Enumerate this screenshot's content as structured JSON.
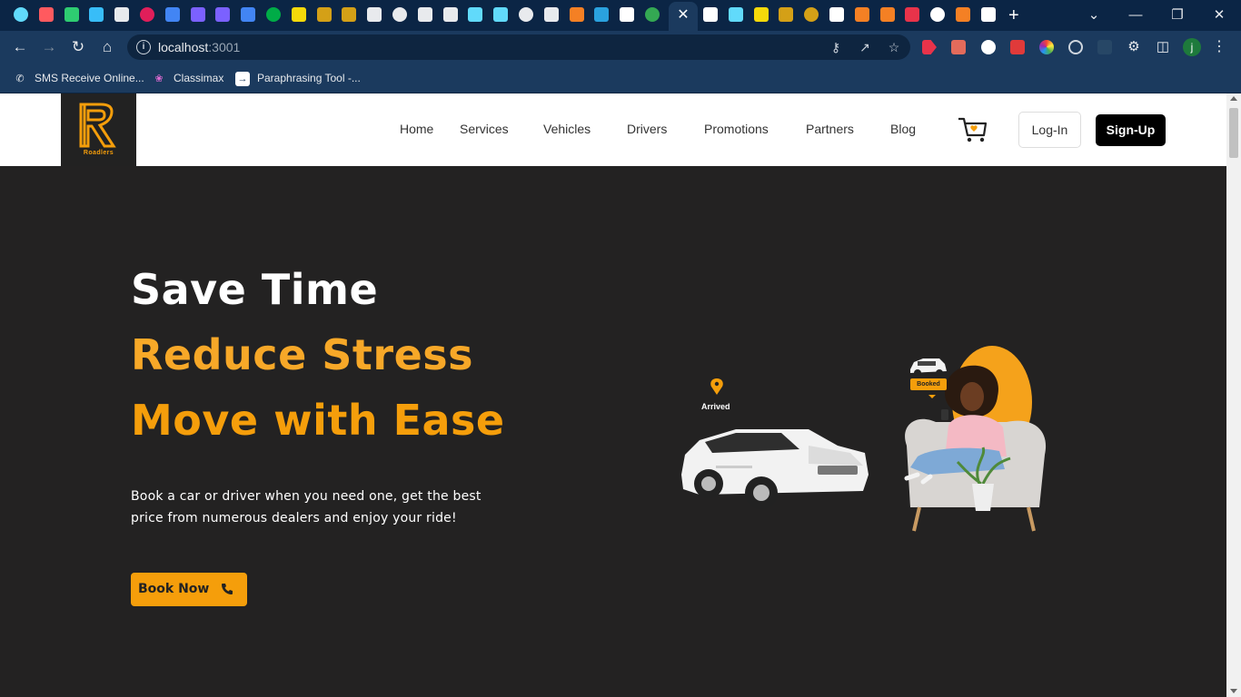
{
  "browser": {
    "tabs_count": 38,
    "active_tab_close": "✕",
    "new_tab": "+",
    "window_controls": {
      "minimize": "—",
      "restore": "❐",
      "close": "✕",
      "tabsearch": "⌄"
    },
    "url_host": "localhost",
    "url_port": ":3001",
    "profile_initial": "j",
    "bookmarks": [
      {
        "label": "SMS Receive Online...",
        "icon": "phone-icon"
      },
      {
        "label": "Classimax",
        "icon": "lotus-icon"
      },
      {
        "label": "Paraphrasing Tool -...",
        "icon": "paraphrase-icon"
      }
    ]
  },
  "site": {
    "logo_text": "Roadlers",
    "nav": [
      "Home",
      "Services",
      "Vehicles",
      "Drivers",
      "Promotions",
      "Partners",
      "Blog"
    ],
    "login_label": "Log-In",
    "signup_label": "Sign-Up",
    "hero": {
      "line1": "Save Time",
      "line2": "Reduce Stress",
      "line3": "Move with Ease",
      "description": "Book a car or driver when you need one, get the best price from numerous dealers and enjoy your ride!",
      "cta_label": "Book Now"
    },
    "illustration": {
      "arrived_label": "Arrived",
      "booked_label": "Booked"
    },
    "colors": {
      "accent": "#f59e0b",
      "background": "#232222",
      "header": "#ffffff"
    }
  }
}
